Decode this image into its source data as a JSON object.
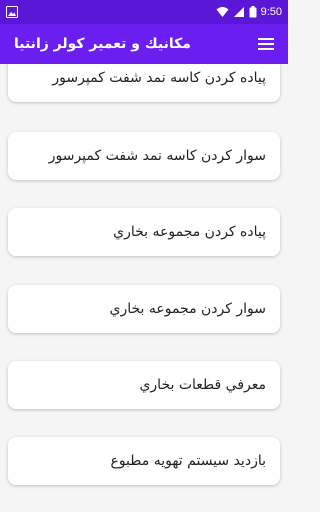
{
  "status_bar": {
    "time": "9:50",
    "left_icons": [
      "image-notification-icon"
    ],
    "right_icons": [
      "wifi-icon",
      "cell-signal-icon",
      "battery-icon"
    ]
  },
  "app_bar": {
    "title": "مكانيك و تعمير كولر زانتيا",
    "menu_icon": "hamburger-menu-icon"
  },
  "colors": {
    "status_bar": "#5a18d6",
    "app_bar": "#6a1ff0",
    "background": "#f5f5f5",
    "card": "#ffffff"
  },
  "items": [
    {
      "label": "پياده كردن كاسه نمد شفت كمپرسور"
    },
    {
      "label": "سوار كردن كاسه نمد شفت كمپرسور"
    },
    {
      "label": "پياده كردن مجموعه بخاري"
    },
    {
      "label": "سوار كردن مجموعه بخاري"
    },
    {
      "label": "معرفي قطعات بخاري"
    },
    {
      "label": "بازديد سيستم تهويه مطبوع"
    }
  ]
}
